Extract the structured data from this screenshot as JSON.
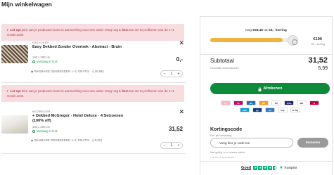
{
  "page": {
    "title": "Mijn winkelwagen"
  },
  "alerts": [
    {
      "prefix": "Let op!",
      "text_before": " Eén van je producten komt in aanmerking voor een actie! Voeg nog ",
      "bold": "1 item",
      "text_after": " toe om te profiteren van de 1+1 Gratis actie."
    },
    {
      "prefix": "Let op!",
      "text_before": " Eén van je producten komt in aanmerking voor een actie! Voeg nog ",
      "bold": "1 item",
      "text_after": " toe om te profiteren van de 1+1 Gratis actie."
    }
  ],
  "items": [
    {
      "brand": "EASYGEEP",
      "name": "Easy Dekbed Zonder Overtrek - Abstract - Bruin",
      "size": "140 x 200 cm",
      "stock": "Vandaag in huis",
      "warranty": "WASBARE DEKBEDDEN 1+1 GRATIS · (-20,85)",
      "price": "0,-",
      "qty": "1",
      "qty_minus": "−",
      "qty_plus": "+",
      "close": "✕"
    },
    {
      "brand": "MCGREGOR",
      "name": "+ Dekbed McGregor - Hotel Deluxe - 4 Seizoenen (100% off)",
      "size": "140 x 200 cm",
      "stock": "Vandaag in huis",
      "warranty": "WASBARE DEKBEDDEN 1+1 GRATIS · (-0,00)",
      "price": "31,52",
      "qty": "1",
      "qty_minus": "−",
      "qty_plus": "+",
      "close": "✕"
    }
  ],
  "summary": {
    "free_prefix": "Nog ",
    "free_amount": "€68,48",
    "free_middle": " tot ",
    "free_bold": "€5,- korting",
    "progress_fraction": 0.84,
    "goal_amount": "€100",
    "goal_label": "€5,- korting",
    "subtotal_label": "Subtotaal",
    "subtotal_value": "31,52",
    "shipping_label": "Geschatte verzendkosten",
    "shipping_value": "5,99",
    "checkout_label": "Afrekenen"
  },
  "payment_methods": [
    {
      "name": "Klarna",
      "color": "#ffb3c7",
      "text": "K."
    },
    {
      "name": "iDEAL",
      "color": "#cc0066",
      "text": "iD"
    },
    {
      "name": "Bancontact",
      "color": "#1e6fb5",
      "text": "BC"
    },
    {
      "name": "Mastercard",
      "color": "#f79e1b",
      "text": "MC"
    },
    {
      "name": "PayPal",
      "color": "#ffffff",
      "text": "PP"
    },
    {
      "name": "Visa",
      "color": "#1a1f71",
      "text": "VISA"
    },
    {
      "name": "Maestro",
      "color": "#ffffff",
      "text": "MA"
    },
    {
      "name": "Belfius",
      "color": "#c30045",
      "text": "B"
    },
    {
      "name": "KBC",
      "color": "#00a1de",
      "text": "KBC"
    },
    {
      "name": "Giropay",
      "color": "#0f3b7d",
      "text": "gp"
    },
    {
      "name": "American Express",
      "color": "#2e77bb",
      "text": "AX"
    },
    {
      "name": "Apple Pay",
      "color": "#ffffff",
      "text": "Pay"
    },
    {
      "name": "Google Pay",
      "color": "#ffffff",
      "text": "G Pay"
    }
  ],
  "coupon": {
    "title": "Kortingscode",
    "subtitle": "Een per bestelling",
    "placeholder": "Voeg hier je code toe",
    "button": "Invoeren",
    "note1": "Niet geldig i.c.m. andere acties",
    "note2": "* Zie ook de voorwaarden"
  },
  "trust": {
    "score_label": "Goed",
    "logo_text": "Trustpilot",
    "stars": 4.5
  }
}
